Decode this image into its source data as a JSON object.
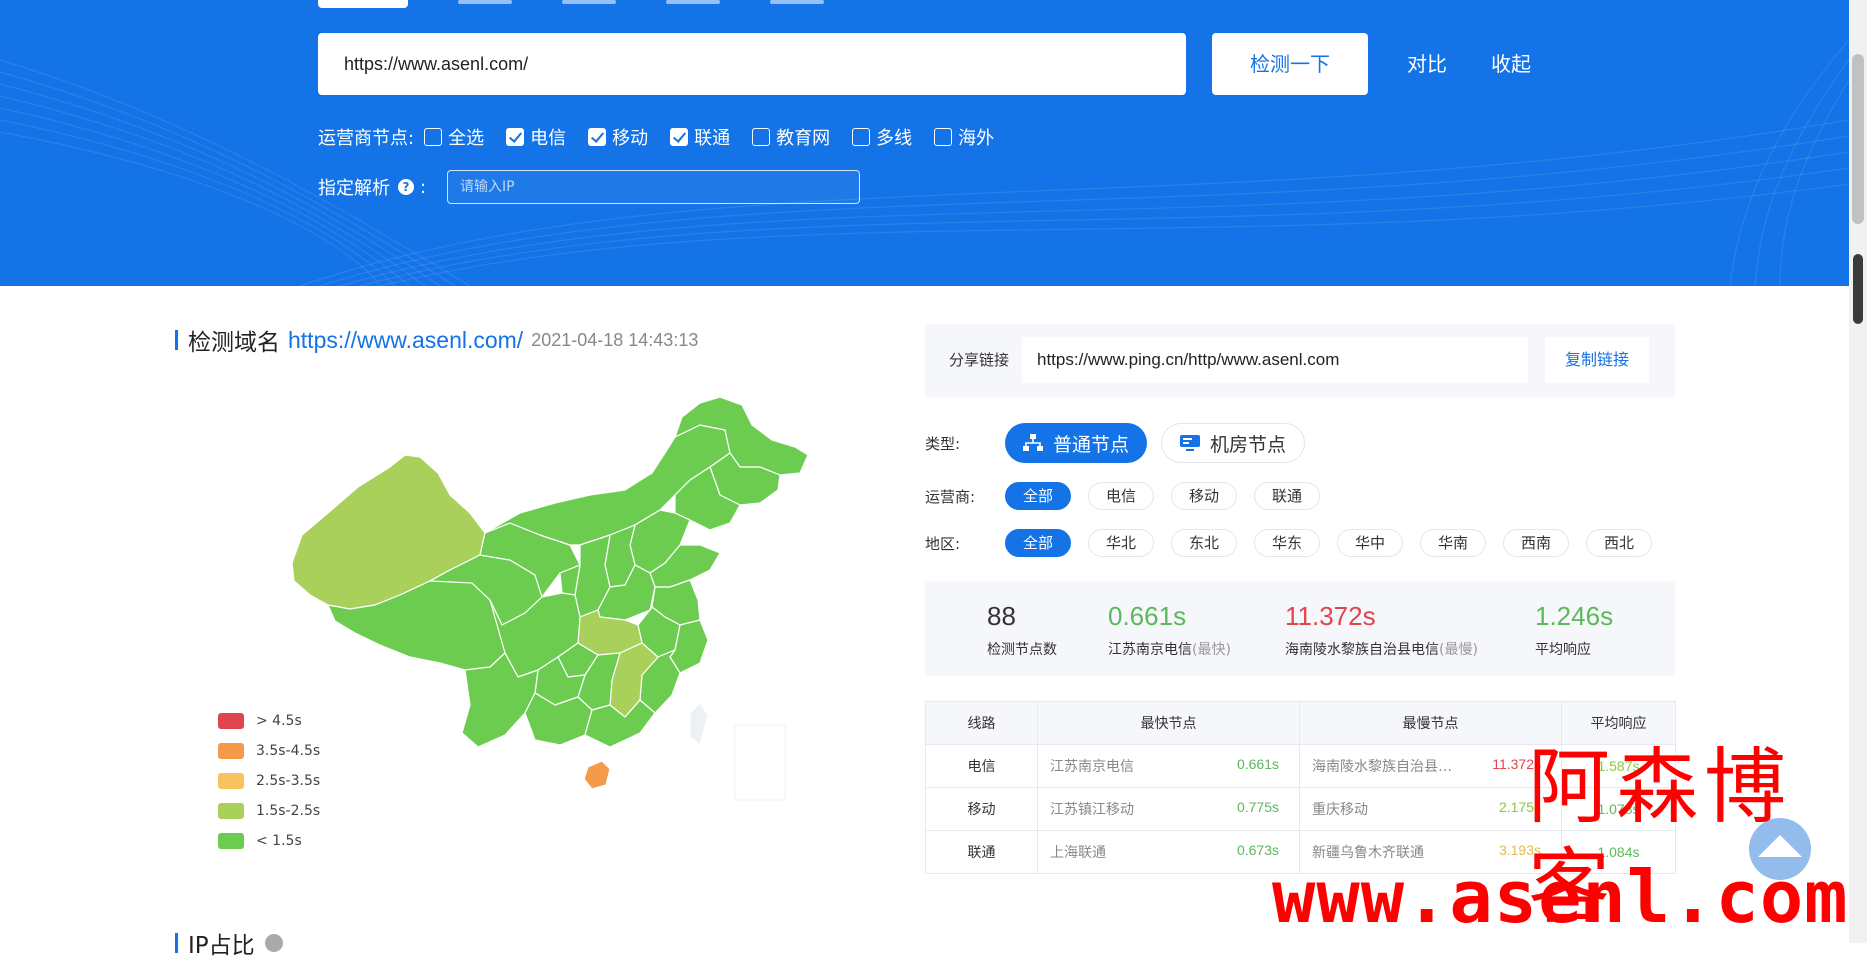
{
  "search": {
    "url_value": "https://www.asenl.com/",
    "detect_button": "检测一下",
    "compare_link": "对比",
    "collapse_link": "收起"
  },
  "isp_filter": {
    "label": "运营商节点:",
    "options": [
      {
        "label": "全选",
        "checked": false
      },
      {
        "label": "电信",
        "checked": true
      },
      {
        "label": "移动",
        "checked": true
      },
      {
        "label": "联通",
        "checked": true
      },
      {
        "label": "教育网",
        "checked": false
      },
      {
        "label": "多线",
        "checked": false
      },
      {
        "label": "海外",
        "checked": false
      }
    ]
  },
  "resolve": {
    "label": "指定解析",
    "colon": ":",
    "placeholder": "请输入IP"
  },
  "result": {
    "title": "检测域名",
    "domain": "https://www.asenl.com/",
    "timestamp": "2021-04-18 14:43:13"
  },
  "legend": [
    {
      "label": "> 4.5s",
      "color": "#e0454f"
    },
    {
      "label": "3.5s-4.5s",
      "color": "#f59a4a"
    },
    {
      "label": "2.5s-3.5s",
      "color": "#f7c35e"
    },
    {
      "label": "1.5s-2.5s",
      "color": "#a8d05b"
    },
    {
      "label": "< 1.5s",
      "color": "#6bcc50"
    }
  ],
  "share": {
    "label": "分享链接",
    "url": "https://www.ping.cn/http/www.asenl.com",
    "copy_button": "复制链接"
  },
  "filters": {
    "type_label": "类型:",
    "types": [
      {
        "label": "普通节点",
        "active": true,
        "icon": "network-icon"
      },
      {
        "label": "机房节点",
        "active": false,
        "icon": "server-icon"
      }
    ],
    "isp_label": "运营商:",
    "isps": [
      {
        "label": "全部",
        "active": true
      },
      {
        "label": "电信",
        "active": false
      },
      {
        "label": "移动",
        "active": false
      },
      {
        "label": "联通",
        "active": false
      }
    ],
    "region_label": "地区:",
    "regions": [
      {
        "label": "全部",
        "active": true
      },
      {
        "label": "华北",
        "active": false
      },
      {
        "label": "东北",
        "active": false
      },
      {
        "label": "华东",
        "active": false
      },
      {
        "label": "华中",
        "active": false
      },
      {
        "label": "华南",
        "active": false
      },
      {
        "label": "西南",
        "active": false
      },
      {
        "label": "西北",
        "active": false
      }
    ]
  },
  "stats": {
    "node_count": "88",
    "node_count_label": "检测节点数",
    "fastest_time": "0.661s",
    "fastest_node": "江苏南京电信",
    "fastest_tag": "(最快)",
    "slowest_time": "11.372s",
    "slowest_node": "海南陵水黎族自治县电信",
    "slowest_tag": "(最慢)",
    "average_time": "1.246s",
    "average_label": "平均响应"
  },
  "table": {
    "headers": [
      "线路",
      "最快节点",
      "最慢节点",
      "平均响应"
    ],
    "rows": [
      {
        "line": "电信",
        "fast_node": "江苏南京电信",
        "fast_time": "0.661s",
        "slow_node": "海南陵水黎族自治县电信",
        "slow_time": "11.372s",
        "avg": "1.587s"
      },
      {
        "line": "移动",
        "fast_node": "江苏镇江移动",
        "fast_time": "0.775s",
        "slow_node": "重庆移动",
        "slow_time": "2.175s",
        "avg": "1.078s"
      },
      {
        "line": "联通",
        "fast_node": "上海联通",
        "fast_time": "0.673s",
        "slow_node": "新疆乌鲁木齐联通",
        "slow_time": "3.193s",
        "avg": "1.084s"
      }
    ]
  },
  "ip_section_title": "IP占比",
  "watermark": {
    "cn": "阿森博客",
    "url": "www.asenl.com"
  }
}
